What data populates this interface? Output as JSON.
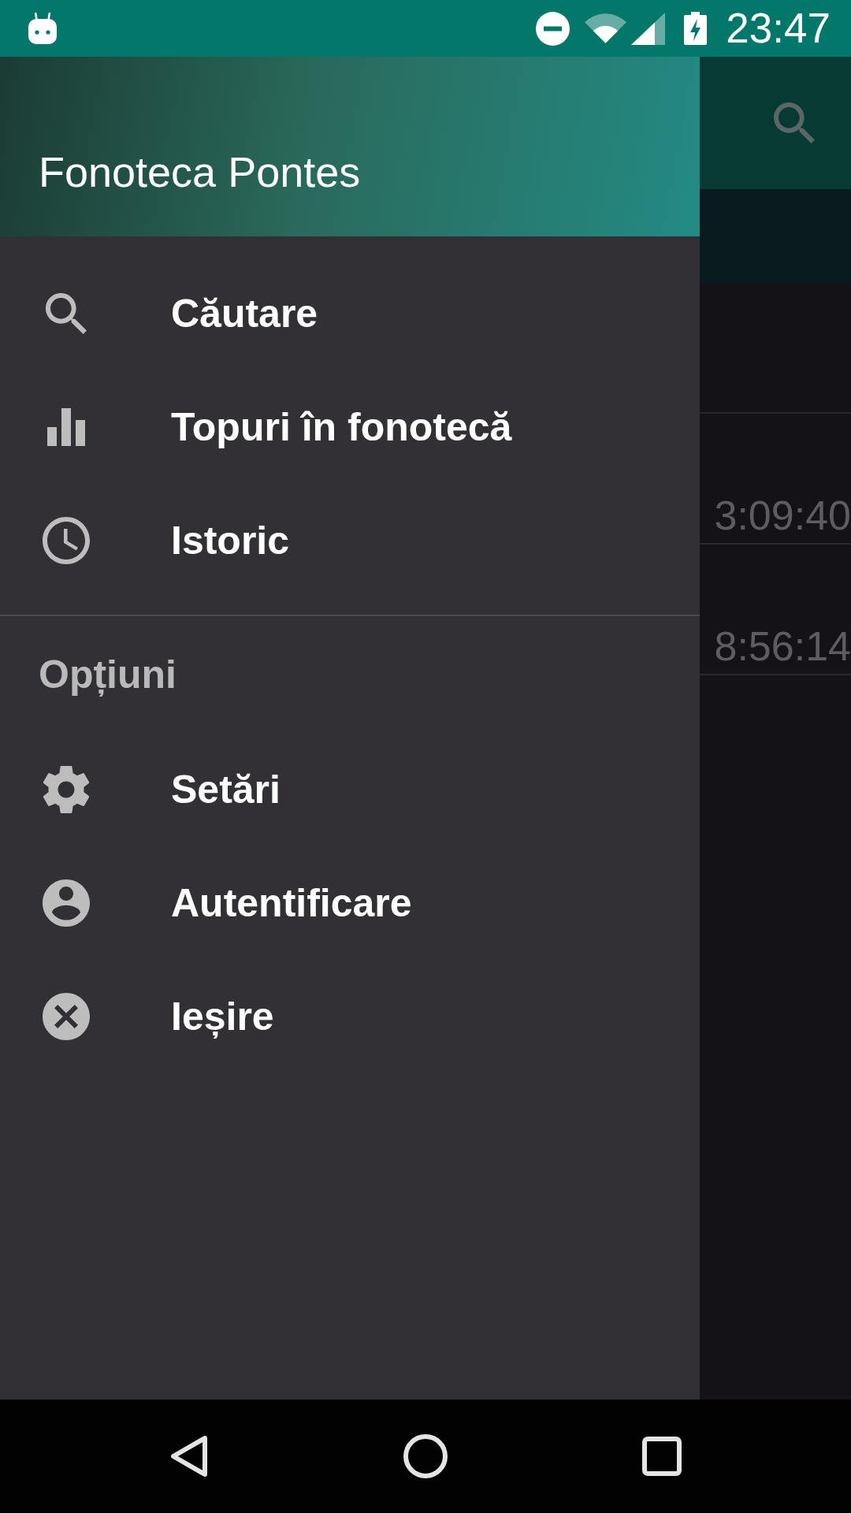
{
  "status_bar": {
    "time": "23:47"
  },
  "background_screen": {
    "list": [
      {
        "time": "3:09:40"
      },
      {
        "time": "8:56:14"
      }
    ]
  },
  "drawer": {
    "title": "Fonoteca Pontes",
    "sections": [
      {
        "items": [
          {
            "label": "Căutare"
          },
          {
            "label": "Topuri în fonotecă"
          },
          {
            "label": "Istoric"
          }
        ]
      },
      {
        "header": "Opțiuni",
        "items": [
          {
            "label": "Setări"
          },
          {
            "label": "Autentificare"
          },
          {
            "label": "Ieșire"
          }
        ]
      }
    ]
  }
}
